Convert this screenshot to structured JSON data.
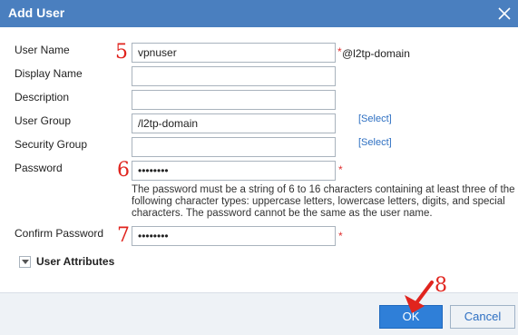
{
  "dialog": {
    "title": "Add User"
  },
  "fields": {
    "user_name": {
      "label": "User Name",
      "value": "vpnuser",
      "suffix": "@l2tp-domain",
      "required_mark": "*"
    },
    "display_name": {
      "label": "Display Name",
      "value": ""
    },
    "description": {
      "label": "Description",
      "value": ""
    },
    "user_group": {
      "label": "User Group",
      "value": "/l2tp-domain",
      "link": "[Select]"
    },
    "security_group": {
      "label": "Security Group",
      "value": "",
      "link": "[Select]"
    },
    "password": {
      "label": "Password",
      "value": "••••••••",
      "required_mark": "*",
      "hint": "The password must be a string of 6 to 16 characters containing at least three of the following character types: uppercase letters, lowercase letters, digits, and special characters. The password cannot be the same as the user name."
    },
    "confirm_password": {
      "label": "Confirm Password",
      "value": "••••••••",
      "required_mark": "*"
    }
  },
  "user_attributes": {
    "label": "User Attributes"
  },
  "annotations": {
    "step5": "5",
    "step6": "6",
    "step7": "7",
    "step8": "8"
  },
  "buttons": {
    "ok": "OK",
    "cancel": "Cancel"
  },
  "icons": {
    "close": "close-icon",
    "collapse": "chevron-down-icon",
    "pointer": "arrow-pointer-icon"
  },
  "colors": {
    "titlebar": "#4a7fbf",
    "annotation": "#e0241e",
    "primary_button": "#2f7fd8",
    "link": "#2d6fc2"
  }
}
